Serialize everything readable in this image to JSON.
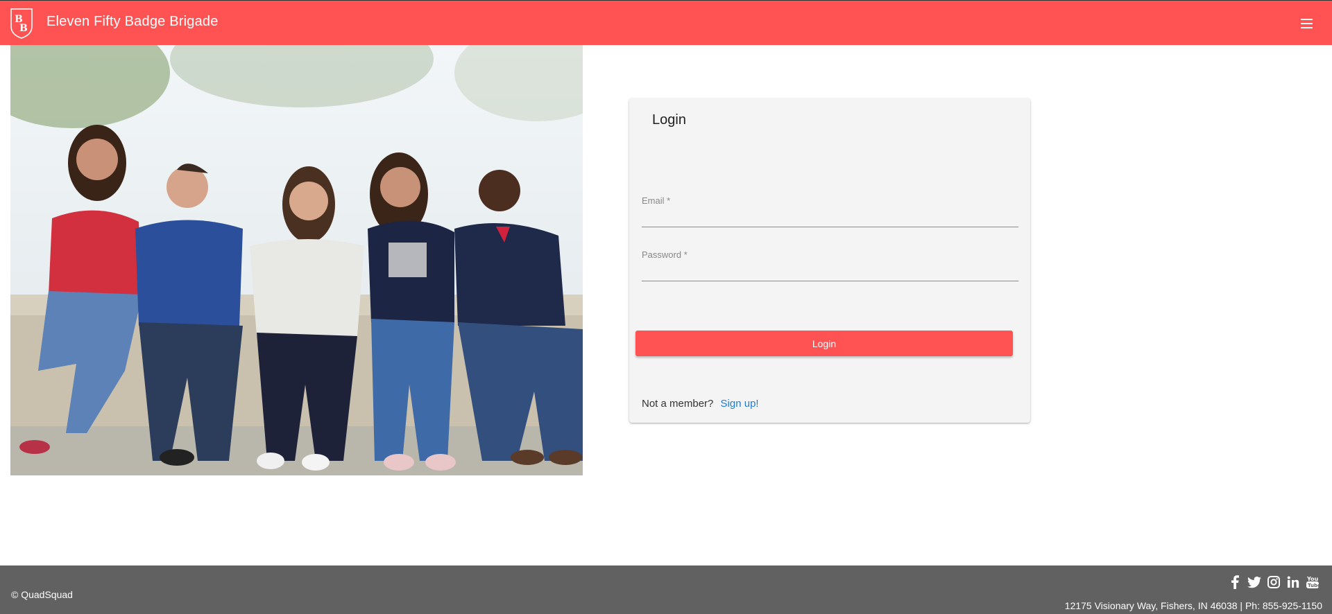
{
  "header": {
    "brand_title": "Eleven Fifty Badge Brigade",
    "logo_text": "BB",
    "accent_color": "#ff5252"
  },
  "hero": {
    "image_subject": "group-of-five-friends-sitting"
  },
  "login_card": {
    "title": "Login",
    "email_label": "Email *",
    "password_label": "Password *",
    "login_button": "Login",
    "not_member_text": "Not a member?",
    "signup_link": "Sign up!"
  },
  "footer": {
    "copyright": "© QuadSquad",
    "address": "12175 Visionary Way, Fishers, IN 46038 | Ph: 855-925-1150",
    "social_icons": [
      "facebook-icon",
      "twitter-icon",
      "instagram-icon",
      "linkedin-icon",
      "youtube-icon"
    ],
    "background_color": "#616161"
  }
}
